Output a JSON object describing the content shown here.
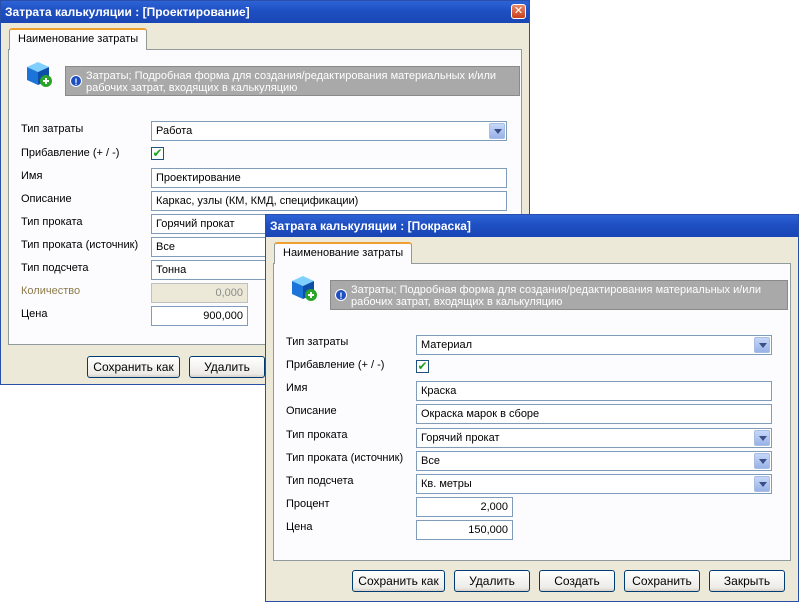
{
  "window1": {
    "title": "Затрата калькуляции : [Проектирование]",
    "tab": "Наименование затраты",
    "info_line1": "Затраты; Подробная форма для создания/редактирования материальных и/или",
    "info_line2": "рабочих затрат, входящих в калькуляцию",
    "labels": {
      "type": "Тип затраты",
      "addition": "Прибавление (+ / -)",
      "name": "Имя",
      "description": "Описание",
      "rolling_type": "Тип проката",
      "rolling_source": "Тип проката (источник)",
      "count_type": "Тип подсчета",
      "quantity": "Количество",
      "price": "Цена"
    },
    "values": {
      "type": "Работа",
      "addition_checked": "✔",
      "name": "Проектирование",
      "description": "Каркас, узлы (КМ, КМД, спецификации)",
      "rolling_type": "Горячий прокат",
      "rolling_source": "Все",
      "count_type": "Тонна",
      "quantity": "0,000",
      "price": "900,000"
    },
    "buttons": {
      "save_as": "Сохранить как",
      "delete": "Удалить"
    }
  },
  "window2": {
    "title": "Затрата калькуляции : [Покраска]",
    "tab": "Наименование затраты",
    "info_line1": "Затраты; Подробная форма для создания/редактирования материальных и/или",
    "info_line2": "рабочих затрат, входящих в калькуляцию",
    "labels": {
      "type": "Тип затраты",
      "addition": "Прибавление (+ / -)",
      "name": "Имя",
      "description": "Описание",
      "rolling_type": "Тип проката",
      "rolling_source": "Тип проката (источник)",
      "count_type": "Тип подсчета",
      "percent": "Процент",
      "price": "Цена"
    },
    "values": {
      "type": "Материал",
      "addition_checked": "✔",
      "name": "Краска",
      "description": "Окраска марок в сборе",
      "rolling_type": "Горячий прокат",
      "rolling_source": "Все",
      "count_type": "Кв. метры",
      "percent": "2,000",
      "price": "150,000"
    },
    "buttons": {
      "save_as": "Сохранить как",
      "delete": "Удалить",
      "create": "Создать",
      "save": "Сохранить",
      "close": "Закрыть"
    }
  },
  "icons": {
    "close": "close-icon",
    "info": "info-icon",
    "cube_add": "cube-add-icon",
    "dropdown": "chevron-down-icon",
    "check": "checkmark-icon"
  },
  "colors": {
    "titlebar": "#1e4fc2",
    "window_bg": "#ece9d8",
    "info_bar": "#a9a9a9",
    "tab_accent": "#f0a030"
  }
}
